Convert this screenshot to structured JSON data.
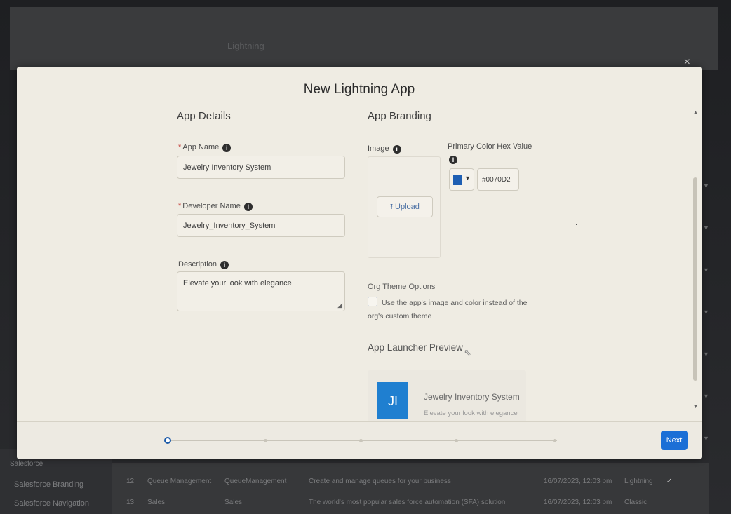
{
  "background": {
    "header_title": "Lightning",
    "close_glyph": "×",
    "sidebar": [
      {
        "label": "Salesforce Branding"
      },
      {
        "label": "Salesforce Navigation"
      }
    ],
    "section_label": "Salesforce",
    "rows": [
      {
        "index": "12",
        "app": "Queue Management",
        "developer": "QueueManagement",
        "description": "Create and manage queues for your business",
        "date": "16/07/2023, 12:03 pm",
        "type": "Lightning",
        "check": "✓"
      },
      {
        "index": "13",
        "app": "Sales",
        "developer": "Sales",
        "description": "The world's most popular sales force automation (SFA) solution",
        "date": "16/07/2023, 12:03 pm",
        "type": "Classic",
        "check": ""
      }
    ]
  },
  "modal": {
    "title": "New Lightning App",
    "app_details": {
      "section_title": "App Details",
      "app_name_label": "App Name",
      "app_name_value": "Jewelry Inventory System",
      "developer_name_label": "Developer Name",
      "developer_name_value": "Jewelry_Inventory_System",
      "description_label": "Description",
      "description_value": "Elevate your look with elegance"
    },
    "app_branding": {
      "section_title": "App Branding",
      "image_label": "Image",
      "upload_label": "Upload",
      "color_label": "Primary Color Hex Value",
      "color_hex": "#0070D2",
      "org_theme_title": "Org Theme Options",
      "org_theme_checkbox_label": "Use the app's image and color instead of the org's custom theme",
      "launcher_preview_title": "App Launcher Preview",
      "preview_initials": "JI",
      "preview_name": "Jewelry Inventory System",
      "preview_description": "Elevate your look with elegance"
    },
    "footer": {
      "next_label": "Next",
      "current_step": 1,
      "total_steps": 5
    }
  },
  "colors": {
    "accent": "#1b6fd6",
    "swatch": "#1f5fb3",
    "tile": "#1f7fd0"
  }
}
